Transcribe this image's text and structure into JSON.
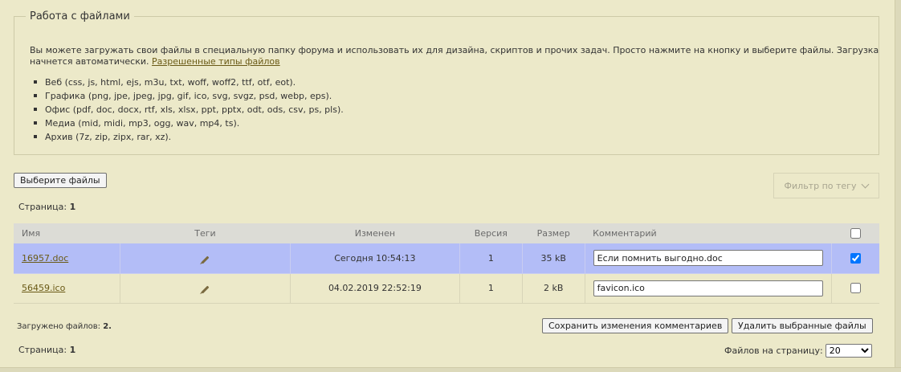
{
  "info": {
    "legend": "Работа с файлами",
    "intro": "Вы можете загружать свои файлы в специальную папку форума и использовать их для дизайна, скриптов и прочих задач. Просто нажмите на кнопку и выберите файлы. Загрузка начнется автоматически.",
    "types_link": "Разрешенные типы файлов",
    "types": [
      "Веб (css, js, html, ejs, m3u, txt, woff, woff2, ttf, otf, eot).",
      "Графика (png, jpe, jpeg, jpg, gif, ico, svg, svgz, psd, webp, eps).",
      "Офис (pdf, doc, docx, rtf, xls, xlsx, ppt, pptx, odt, ods, csv, ps, pls).",
      "Медиа (mid, midi, mp3, ogg, wav, mp4, ts).",
      "Архив (7z, zip, zipx, rar, xz)."
    ]
  },
  "toolbar": {
    "choose_label": "Выберите файлы",
    "filter_label": "Фильтр по тегу",
    "filter_icon": "chevron-down-icon"
  },
  "pager": {
    "label": "Страница:",
    "page": "1"
  },
  "table": {
    "headers": {
      "name": "Имя",
      "tags": "Теги",
      "modified": "Изменен",
      "version": "Версия",
      "size": "Размер",
      "comment": "Комментарий"
    },
    "rows": [
      {
        "name": "16957.doc",
        "modified": "Сегодня 10:54:13",
        "version": "1",
        "size": "35 kB",
        "comment": "Если помнить выгодно.doc",
        "checked": true
      },
      {
        "name": "56459.ico",
        "modified": "04.02.2019 22:52:19",
        "version": "1",
        "size": "2 kB",
        "comment": "favicon.ico",
        "checked": false
      }
    ],
    "tag_icon": "pencil-icon"
  },
  "footer": {
    "uploaded_label": "Загружено файлов:",
    "uploaded_count": "2.",
    "save_label": "Сохранить изменения комментариев",
    "delete_label": "Удалить выбранные файлы",
    "per_page_label": "Файлов на страницу:",
    "per_page_value": "20"
  },
  "colors": {
    "background": "#ece9c9",
    "selected_row": "#b3bdf7",
    "link": "#6a5a16",
    "header_bg": "#dcdcd6"
  }
}
